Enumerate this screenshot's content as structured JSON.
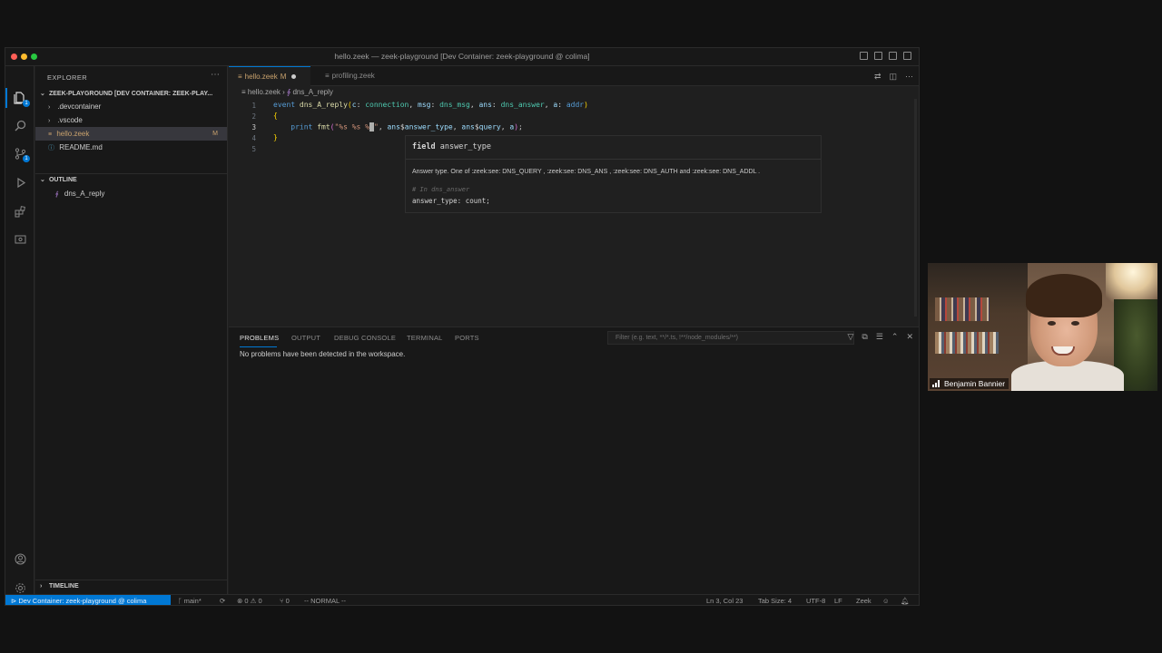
{
  "window": {
    "title": "hello.zeek — zeek-playground [Dev Container: zeek-playground @ colima]",
    "traffic_colors": [
      "#ff5f57",
      "#febc2e",
      "#28c840"
    ]
  },
  "sidebar": {
    "header": "EXPLORER",
    "root_folder": "ZEEK-PLAYGROUND [DEV CONTAINER: ZEEK-PLAY...",
    "tree": [
      {
        "label": ".devcontainer",
        "type": "folder"
      },
      {
        "label": ".vscode",
        "type": "folder"
      },
      {
        "label": "hello.zeek",
        "type": "file",
        "badge": "M",
        "selected": true
      },
      {
        "label": "README.md",
        "type": "file"
      }
    ],
    "outline_header": "OUTLINE",
    "outline_items": [
      "dns_A_reply"
    ],
    "timeline_header": "TIMELINE"
  },
  "tabs": [
    {
      "label": "hello.zeek",
      "modified": "M",
      "active": true
    },
    {
      "label": "profiling.zeek",
      "active": false
    }
  ],
  "breadcrumb": {
    "file": "hello.zeek",
    "symbol": "dns_A_reply"
  },
  "editor": {
    "line_numbers": [
      "1",
      "2",
      "3",
      "4",
      "5"
    ],
    "cursor": "Ln 3, Col 23"
  },
  "hover": {
    "signature_kind": "field",
    "signature_name": "answer_type",
    "doc": "Answer type. One of :zeek:see: DNS_QUERY , :zeek:see: DNS_ANS , :zeek:see: DNS_AUTH  and :zeek:see: DNS_ADDL .",
    "comment": "# In dns_answer",
    "declaration": "answer_type: count;"
  },
  "panel": {
    "tabs": [
      "PROBLEMS",
      "OUTPUT",
      "DEBUG CONSOLE",
      "TERMINAL",
      "PORTS"
    ],
    "active_tab": "PROBLEMS",
    "filter_placeholder": "Filter (e.g. text, **/*.ts, !**/node_modules/**)",
    "message": "No problems have been detected in the workspace."
  },
  "statusbar": {
    "remote": "Dev Container: zeek-playground @ colima",
    "branch": "main*",
    "errors": "0",
    "warnings": "0",
    "ports": "0",
    "mode": "-- NORMAL --",
    "position": "Ln 3, Col 23",
    "tab_size": "Tab Size: 4",
    "encoding": "UTF-8",
    "eol": "LF",
    "language": "Zeek"
  },
  "webcam": {
    "name": "Benjamin Bannier"
  },
  "colors": {
    "accent": "#0078d4",
    "modified": "#c9a26d"
  }
}
